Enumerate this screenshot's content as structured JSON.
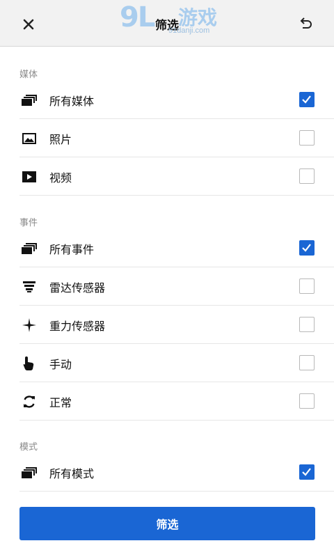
{
  "header": {
    "title": "筛选",
    "close_icon": "close-icon",
    "undo_icon": "undo-icon"
  },
  "watermark": {
    "big": "9L",
    "cn": "游戏",
    "url": "91danji.com"
  },
  "sections": {
    "media": {
      "label": "媒体",
      "items": [
        {
          "label": "所有媒体",
          "icon": "stack-icon",
          "checked": true
        },
        {
          "label": "照片",
          "icon": "photo-icon",
          "checked": false
        },
        {
          "label": "视频",
          "icon": "video-icon",
          "checked": false
        }
      ]
    },
    "events": {
      "label": "事件",
      "items": [
        {
          "label": "所有事件",
          "icon": "stack-icon",
          "checked": true
        },
        {
          "label": "雷达传感器",
          "icon": "radar-icon",
          "checked": false
        },
        {
          "label": "重力传感器",
          "icon": "gravity-icon",
          "checked": false
        },
        {
          "label": "手动",
          "icon": "hand-icon",
          "checked": false
        },
        {
          "label": "正常",
          "icon": "refresh-icon",
          "checked": false
        }
      ]
    },
    "modes": {
      "label": "模式",
      "items": [
        {
          "label": "所有模式",
          "icon": "stack-icon",
          "checked": true
        }
      ]
    }
  },
  "apply_button": {
    "label": "筛选"
  },
  "colors": {
    "accent": "#1a66d4",
    "header_bg": "#f2f2f2",
    "watermark": "#a9cdee"
  }
}
